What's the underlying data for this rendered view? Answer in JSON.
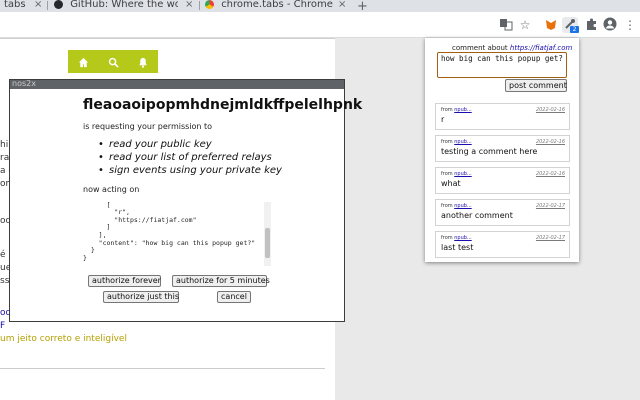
{
  "browser": {
    "tabs": [
      {
        "title": "tabs",
        "favicon": "page-icon",
        "color": "#5f6368"
      },
      {
        "title": "GitHub: Where the world",
        "favicon": "github-icon",
        "color": "#24292e"
      },
      {
        "title": "chrome.tabs - Chrome De",
        "favicon": "chrome-icon",
        "color": "#4285f4",
        "active": true
      }
    ],
    "new_tab_symbol": "+",
    "close_symbol": "×",
    "toolbar_icons": [
      "translate-icon",
      "bookmark-star-icon",
      "fox-extension-icon",
      "nos2x-extension-icon",
      "puzzle-icon",
      "profile-icon",
      "more-icon"
    ],
    "extension_badge": "2"
  },
  "website": {
    "accent_color": "#b5c91a",
    "nav_icons": [
      "home-icon",
      "search-icon",
      "bell-icon"
    ],
    "fragments": [
      "hi",
      "ra",
      "a d",
      "om",
      "oo",
      "é",
      "uel",
      "ssi",
      "oo",
      "F"
    ],
    "link_text": "um jeito correto e inteligível"
  },
  "prompt": {
    "window_title": "nos2x",
    "extension_id": "fleaoaoipopmhdnejmldkffpelelhpnk",
    "request_line": "is requesting your permission to",
    "permissions": [
      "read your public key",
      "read your list of preferred relays",
      "sign events using your private key"
    ],
    "acting_on_label": "now acting on",
    "event_json": "  ...\n      [\n        \"r\",\n        \"https://fiatjaf.com\"\n      ]\n    ],\n    \"content\": \"how big can this popup get?\"\n  }\n}",
    "buttons": {
      "authorize_forever": "authorize forever",
      "authorize_5min": "authorize for 5 minutes",
      "authorize_once": "authorize just this",
      "cancel": "cancel"
    }
  },
  "popup": {
    "header_prefix": "comment about",
    "header_url": "https://fiatjaf.com",
    "comment_value": "how big can this popup get?",
    "post_label": "post comment",
    "comments": [
      {
        "from_label": "from",
        "author": "npub...",
        "date": "2022-02-16",
        "text": "r"
      },
      {
        "from_label": "from",
        "author": "npub...",
        "date": "2022-02-16",
        "text": "testing a comment here"
      },
      {
        "from_label": "from",
        "author": "npub...",
        "date": "2022-02-16",
        "text": "what"
      },
      {
        "from_label": "from",
        "author": "npub...",
        "date": "2022-02-17",
        "text": "another comment"
      },
      {
        "from_label": "from",
        "author": "npub...",
        "date": "2022-02-17",
        "text": "last test"
      }
    ]
  }
}
